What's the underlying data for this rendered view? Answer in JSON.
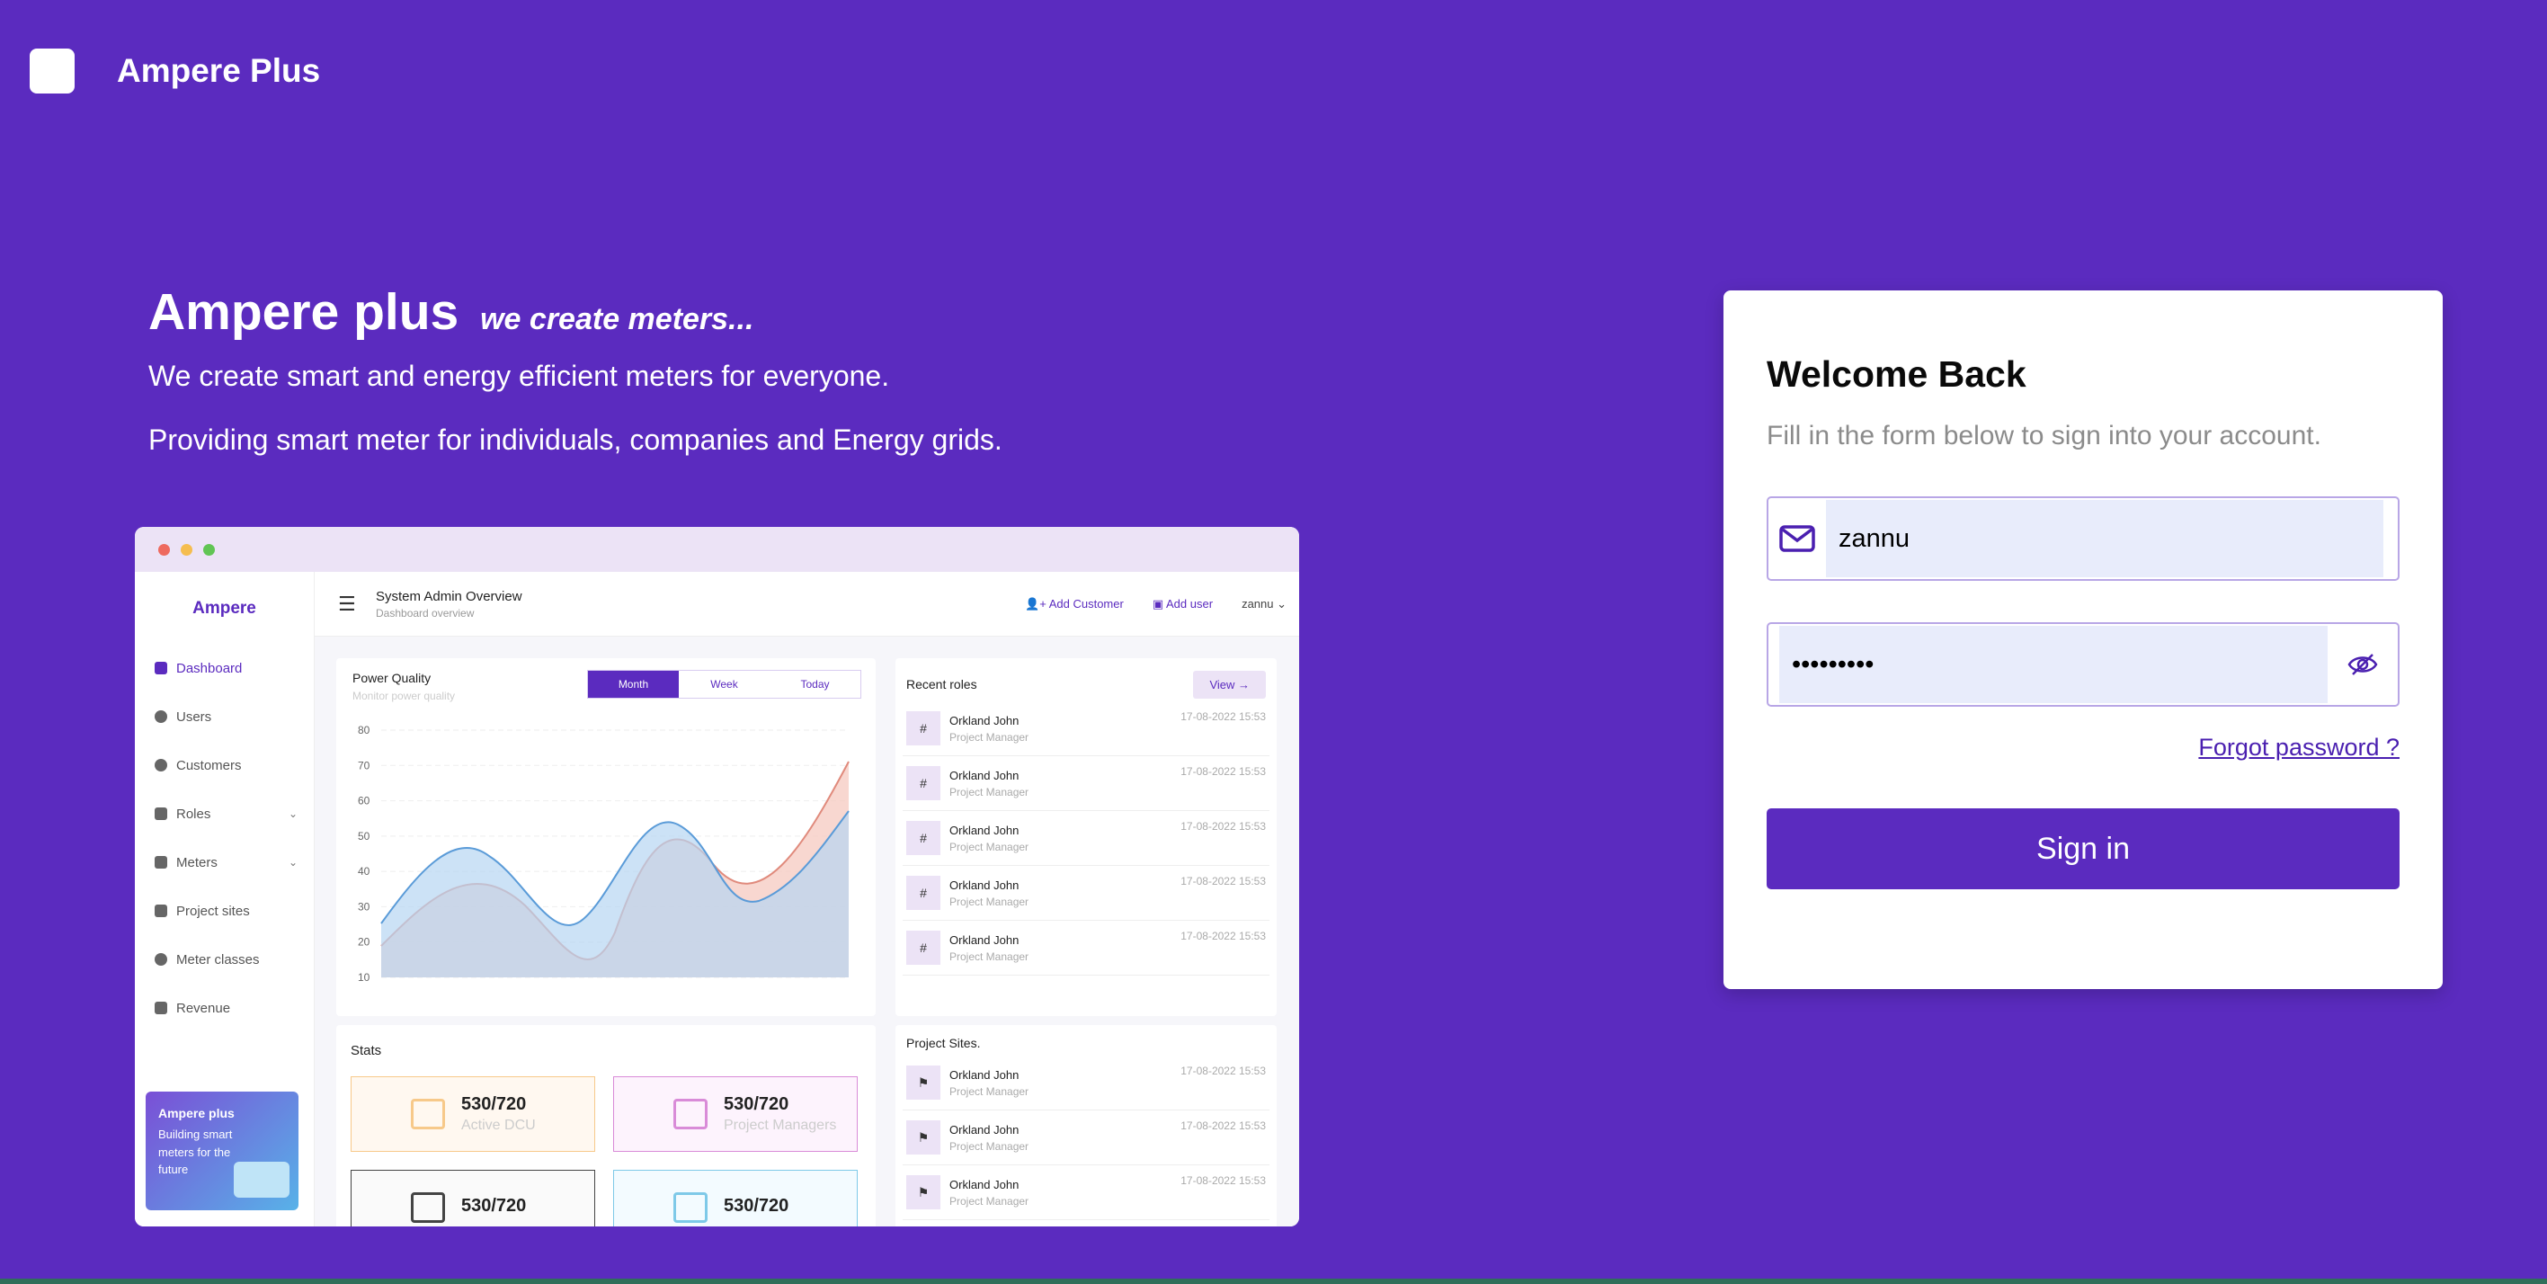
{
  "brand": {
    "name": "Ampere Plus"
  },
  "hero": {
    "title": "Ampere plus",
    "tagline": "we create meters...",
    "line1": "We create smart and energy efficient meters for everyone.",
    "line2": "Providing smart meter for individuals, companies and Energy grids."
  },
  "preview": {
    "logo": "Ampere",
    "nav": [
      {
        "label": "Dashboard",
        "icon": "grid-icon"
      },
      {
        "label": "Users",
        "icon": "user-icon"
      },
      {
        "label": "Customers",
        "icon": "user-icon"
      },
      {
        "label": "Roles",
        "icon": "group-icon"
      },
      {
        "label": "Meters",
        "icon": "meter-icon"
      },
      {
        "label": "Project sites",
        "icon": "building-icon"
      },
      {
        "label": "Meter classes",
        "icon": "gauge-icon"
      },
      {
        "label": "Revenue",
        "icon": "wallet-icon"
      }
    ],
    "promo": {
      "title": "Ampere plus",
      "text": "Building smart meters for the future"
    },
    "header": {
      "title": "System Admin Overview",
      "subtitle": "Dashboard overview",
      "add_customer": "Add Customer",
      "add_user": "Add user",
      "user": "zannu"
    },
    "power_quality": {
      "title": "Power Quality",
      "subtitle": "Monitor power quality",
      "tabs": [
        "Month",
        "Week",
        "Today"
      ],
      "y_ticks": [
        "80",
        "70",
        "60",
        "50",
        "40",
        "30",
        "20",
        "10"
      ]
    },
    "recent_roles": {
      "title": "Recent roles",
      "view": "View →",
      "rows": [
        {
          "name": "Orkland John",
          "role": "Project Manager",
          "time": "17-08-2022 15:53"
        },
        {
          "name": "Orkland John",
          "role": "Project Manager",
          "time": "17-08-2022 15:53"
        },
        {
          "name": "Orkland John",
          "role": "Project Manager",
          "time": "17-08-2022 15:53"
        },
        {
          "name": "Orkland John",
          "role": "Project Manager",
          "time": "17-08-2022 15:53"
        },
        {
          "name": "Orkland John",
          "role": "Project Manager",
          "time": "17-08-2022 15:53"
        }
      ]
    },
    "stats": {
      "title": "Stats",
      "boxes": [
        {
          "value": "530/720",
          "label": "Active DCU",
          "color": "#f7c98a",
          "bg": "#fff8f0"
        },
        {
          "value": "530/720",
          "label": "Project Managers",
          "color": "#d98bd8",
          "bg": "#fdf3fd"
        },
        {
          "value": "530/720",
          "label": "",
          "color": "#444444",
          "bg": "#fafafa"
        },
        {
          "value": "530/720",
          "label": "",
          "color": "#7ec9e8",
          "bg": "#f3fbff"
        }
      ]
    },
    "project_sites": {
      "title": "Project Sites.",
      "rows": [
        {
          "name": "Orkland John",
          "role": "Project Manager",
          "time": "17-08-2022 15:53"
        },
        {
          "name": "Orkland John",
          "role": "Project Manager",
          "time": "17-08-2022 15:53"
        },
        {
          "name": "Orkland John",
          "role": "Project Manager",
          "time": "17-08-2022 15:53"
        }
      ]
    }
  },
  "login": {
    "title": "Welcome Back",
    "subtitle": "Fill in the form below to sign into your account.",
    "email_value": "zannu",
    "password_value": "•••••••••",
    "forgot": "Forgot password ?",
    "signin": "Sign in"
  },
  "colors": {
    "brand": "#5b2bbf",
    "field_bg": "#e8ecfb"
  }
}
